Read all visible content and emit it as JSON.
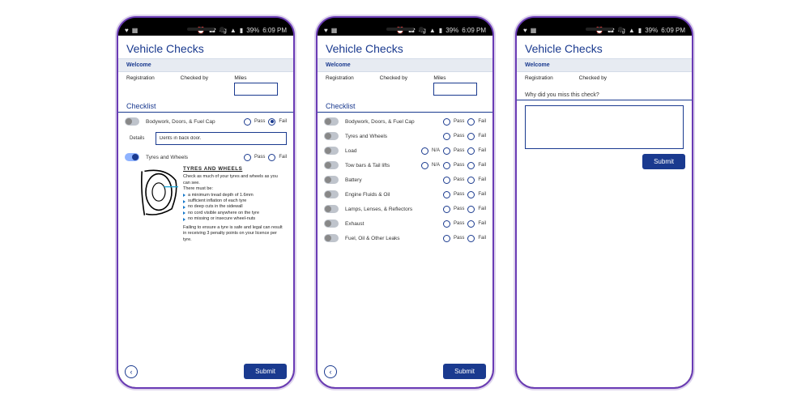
{
  "status": {
    "left_icons": [
      "♥",
      "▦"
    ],
    "right_icons": [
      "⏰",
      "☎",
      "4g",
      "▲",
      "▮"
    ],
    "battery": "39%",
    "time": "6:09 PM"
  },
  "app_title": "Vehicle Checks",
  "welcome": "Welcome",
  "fields": {
    "registration": "Registration",
    "checked_by": "Checked by",
    "miles": "Miles"
  },
  "checklist_heading": "Checklist",
  "radio": {
    "pass": "Pass",
    "fail": "Fail",
    "na": "N/A"
  },
  "screen1": {
    "items": [
      {
        "label": "Bodywork, Doors, & Fuel Cap"
      },
      {
        "label": "Tyres and Wheels"
      }
    ],
    "details_label": "Details",
    "details_value": "Dents in back door.",
    "info": {
      "title": "TYRES AND WHEELS",
      "intro1": "Check as much of your tyres and wheels as you can see.",
      "intro2": "There must be:",
      "bullets": [
        "a minimum tread depth of 1.6mm",
        "sufficient inflation of each tyre",
        "no deep cuts in the sidewall",
        "no cord visible anywhere on the tyre",
        "no missing or insecure wheel-nuts"
      ],
      "warning": "Failing to ensure a tyre is safe and legal can result in receiving 3 penalty points on your licence per tyre."
    }
  },
  "screen2": {
    "items": [
      {
        "label": "Bodywork, Doors, & Fuel Cap",
        "na": false
      },
      {
        "label": "Tyres and Wheels",
        "na": false
      },
      {
        "label": "Load",
        "na": true
      },
      {
        "label": "Tow bars & Tail lifts",
        "na": true
      },
      {
        "label": "Battery",
        "na": false
      },
      {
        "label": "Engine Fluids & Oil",
        "na": false
      },
      {
        "label": "Lamps, Lenses, & Reflectors",
        "na": false
      },
      {
        "label": "Exhaust",
        "na": false
      },
      {
        "label": "Fuel, Oil & Other Leaks",
        "na": false
      }
    ]
  },
  "screen3": {
    "question": "Why did you miss this check?"
  },
  "submit": "Submit"
}
